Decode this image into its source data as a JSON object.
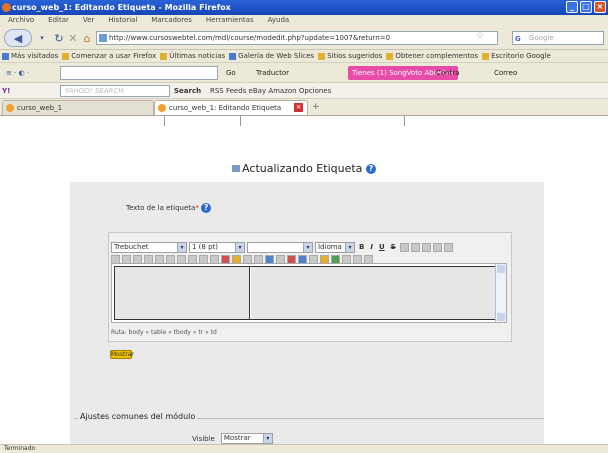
{
  "window": {
    "title": "curso_web_1: Editando Etiqueta - Mozilla Firefox"
  },
  "menu": [
    "Archivo",
    "Editar",
    "Ver",
    "Historial",
    "Marcadores",
    "Herramientas",
    "Ayuda"
  ],
  "nav": {
    "url": "http://www.cursoswebtel.com/mdl/course/modedit.php?update=1007&return=0",
    "search_placeholder": "Google"
  },
  "bookmarks": [
    "Más visitados",
    "Comenzar a usar Firefox",
    "Últimas noticias",
    "Galería de Web Slices",
    "Sitios sugeridos",
    "Obtener complementos",
    "Escritorio Google"
  ],
  "toolbar3": {
    "send_label": "Go",
    "translate_label": "Traductor",
    "pink_label": "Tienes (1) SongVoto Abiertas",
    "btn_a": "Contra",
    "btn_b": "Correo"
  },
  "yahoo": {
    "brand": "YAHOO! SEARCH",
    "search_btn": "Search",
    "links": "RSS Feeds  eBay  Amazon  Opciones"
  },
  "tabs": [
    {
      "label": "curso_web_1"
    },
    {
      "label": "curso_web_1: Editando Etiqueta"
    }
  ],
  "page": {
    "title": "Actualizando Etiqueta",
    "field_label": "Texto de la etiqueta",
    "required_mark": "*",
    "editor": {
      "font_select": "Trebuchet",
      "size_select": "1 (8 pt)",
      "style_select": "",
      "lang_select": "Idioma",
      "bold": "B",
      "italic": "I",
      "underline": "U",
      "strike": "S",
      "path_label": "Ruta: body » table » tbody » tr » td"
    },
    "badge": "Mostrar",
    "fieldset_legend": "Ajustes comunes del módulo",
    "visible_label": "Visible",
    "visible_value": "Mostrar"
  },
  "status": "Terminado"
}
